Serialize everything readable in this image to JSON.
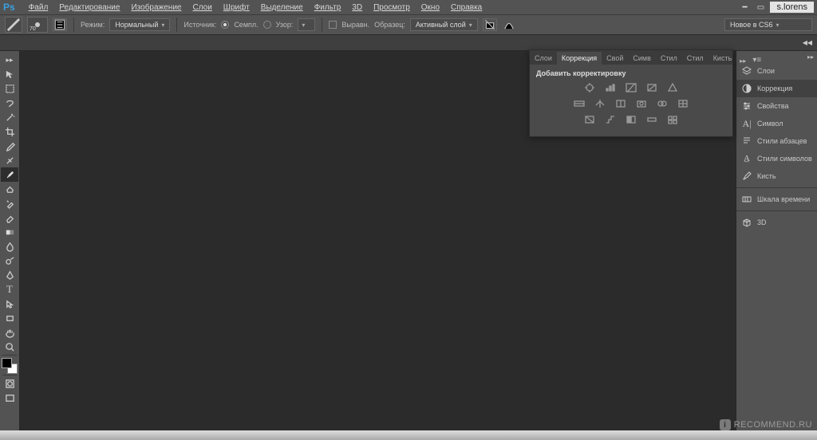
{
  "user_tag": "s.lorens",
  "menu": {
    "file": "Файл",
    "edit": "Редактирование",
    "image": "Изображение",
    "layers": "Слои",
    "type": "Шрифт",
    "select": "Выделение",
    "filter": "Фильтр",
    "3d": "3D",
    "view": "Просмотр",
    "window": "Окно",
    "help": "Справка"
  },
  "options": {
    "brush_size": "70",
    "mode_label": "Режим:",
    "mode_value": "Нормальный",
    "source_label": "Источник:",
    "sampled_label": "Семпл.",
    "pattern_label": "Узор:",
    "aligned_label": "Выравн.",
    "sample_label": "Образец:",
    "sample_value": "Активный слой",
    "workspace_select": "Новое в CS6"
  },
  "float_panel": {
    "tabs": [
      "Слои",
      "Коррекция",
      "Свой",
      "Симв",
      "Стил",
      "Стил",
      "Кисть"
    ],
    "active_tab": 1,
    "title": "Добавить корректировку"
  },
  "right_dock": {
    "items_top": [
      {
        "name": "layers",
        "label": "Слои"
      },
      {
        "name": "adjustments",
        "label": "Коррекция"
      },
      {
        "name": "properties",
        "label": "Свойства"
      },
      {
        "name": "character",
        "label": "Символ"
      },
      {
        "name": "paragraph-styles",
        "label": "Стили абзацев"
      },
      {
        "name": "character-styles",
        "label": "Стили символов"
      },
      {
        "name": "brush",
        "label": "Кисть"
      }
    ],
    "items_mid": [
      {
        "name": "timeline",
        "label": "Шкала времени"
      }
    ],
    "items_bot": [
      {
        "name": "3d",
        "label": "3D"
      }
    ],
    "selected": "adjustments"
  },
  "tools": [
    "move",
    "rect-marquee",
    "lasso",
    "magic-wand",
    "crop",
    "eyedropper",
    "spot-heal",
    "brush",
    "clone-stamp",
    "history-brush",
    "eraser",
    "gradient",
    "blur",
    "dodge",
    "pen",
    "type",
    "path-select",
    "rectangle",
    "hand",
    "zoom"
  ],
  "watermark": "RECOMMEND.RU"
}
